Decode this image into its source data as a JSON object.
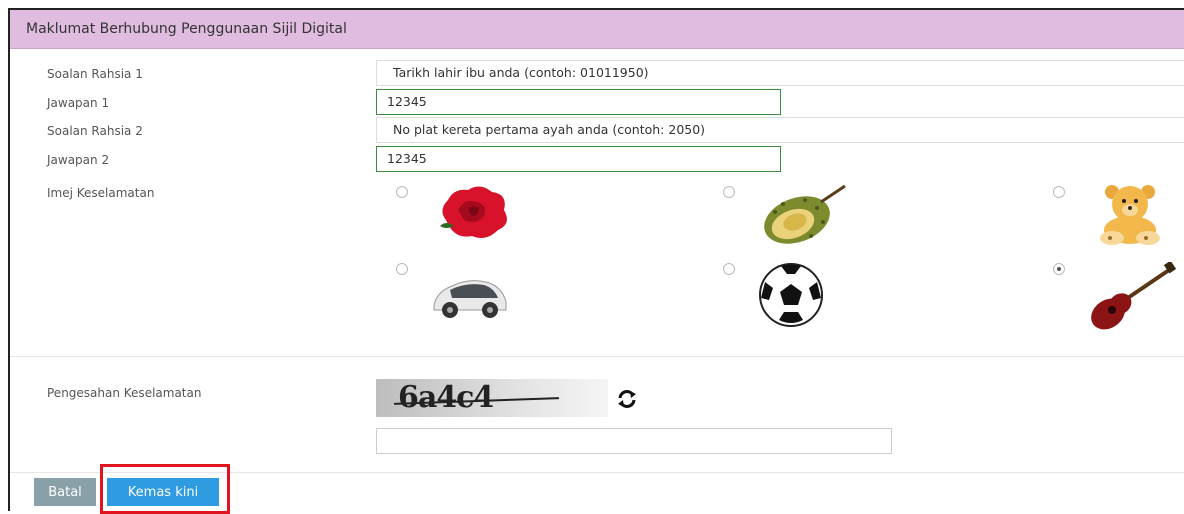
{
  "panel": {
    "title": "Maklumat Berhubung Penggunaan Sijil Digital"
  },
  "form": {
    "q1_label": "Soalan Rahsia 1",
    "q1_value": "Tarikh lahir ibu anda (contoh: 01011950)",
    "a1_label": "Jawapan 1",
    "a1_value": "12345",
    "q2_label": "Soalan Rahsia 2",
    "q2_value": "No plat kereta pertama ayah anda (contoh: 2050)",
    "a2_label": "Jawapan 2",
    "a2_value": "12345",
    "image_label": "Imej Keselamatan",
    "security_images": [
      {
        "name": "rose",
        "selected": false
      },
      {
        "name": "durian",
        "selected": false
      },
      {
        "name": "teddy-bear",
        "selected": false
      },
      {
        "name": "car",
        "selected": false
      },
      {
        "name": "soccer-ball",
        "selected": false
      },
      {
        "name": "guitar",
        "selected": true
      }
    ],
    "captcha_label": "Pengesahan Keselamatan",
    "captcha_text": "6a4c4",
    "captcha_input": ""
  },
  "buttons": {
    "cancel": "Batal",
    "update": "Kemas kini"
  },
  "colors": {
    "header_bg": "#e0bde0",
    "update_button": "#2f9be0",
    "cancel_button": "#8aa0a8",
    "highlight": "#e0141e",
    "input_border_active": "#3c8a3c"
  }
}
